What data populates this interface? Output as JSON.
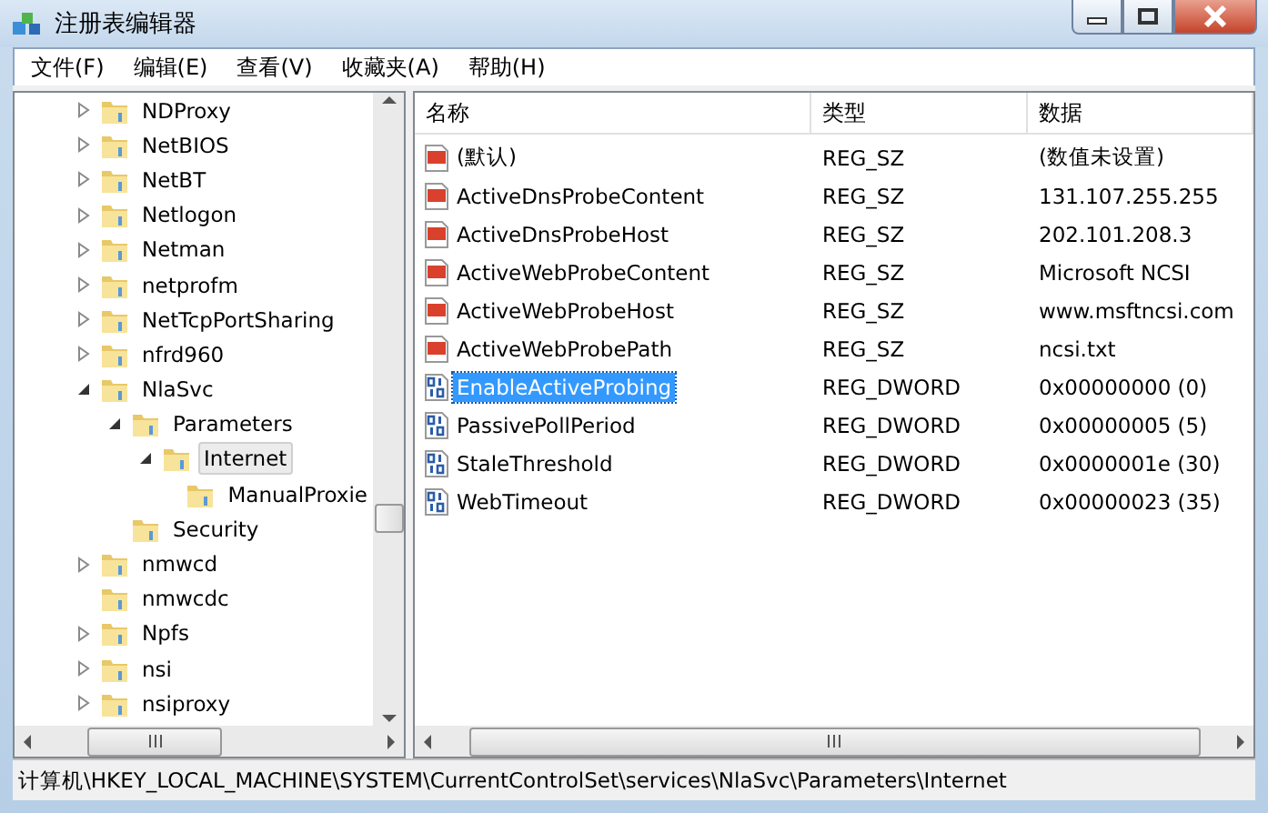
{
  "window": {
    "title": "注册表编辑器"
  },
  "menu": [
    {
      "label": "文件(F)"
    },
    {
      "label": "编辑(E)"
    },
    {
      "label": "查看(V)"
    },
    {
      "label": "收藏夹(A)"
    },
    {
      "label": "帮助(H)"
    }
  ],
  "tree": [
    {
      "label": "NDProxy",
      "expandable": true,
      "expanded": false,
      "selected": false
    },
    {
      "label": "NetBIOS",
      "expandable": true,
      "expanded": false,
      "selected": false
    },
    {
      "label": "NetBT",
      "expandable": true,
      "expanded": false,
      "selected": false
    },
    {
      "label": "Netlogon",
      "expandable": true,
      "expanded": false,
      "selected": false
    },
    {
      "label": "Netman",
      "expandable": true,
      "expanded": false,
      "selected": false
    },
    {
      "label": "netprofm",
      "expandable": true,
      "expanded": false,
      "selected": false
    },
    {
      "label": "NetTcpPortSharing",
      "expandable": true,
      "expanded": false,
      "selected": false
    },
    {
      "label": "nfrd960",
      "expandable": true,
      "expanded": false,
      "selected": false
    },
    {
      "label": "NlaSvc",
      "expandable": true,
      "expanded": true,
      "selected": false,
      "children": [
        {
          "label": "Parameters",
          "expandable": true,
          "expanded": true,
          "selected": false,
          "children": [
            {
              "label": "Internet",
              "expandable": true,
              "expanded": true,
              "selected": true,
              "children": [
                {
                  "label": "ManualProxie",
                  "expandable": false,
                  "expanded": false,
                  "selected": false
                }
              ]
            }
          ]
        },
        {
          "label": "Security",
          "expandable": false,
          "expanded": false,
          "selected": false
        }
      ]
    },
    {
      "label": "nmwcd",
      "expandable": true,
      "expanded": false,
      "selected": false
    },
    {
      "label": "nmwcdc",
      "expandable": false,
      "expanded": false,
      "selected": false
    },
    {
      "label": "Npfs",
      "expandable": true,
      "expanded": false,
      "selected": false
    },
    {
      "label": "nsi",
      "expandable": true,
      "expanded": false,
      "selected": false
    },
    {
      "label": "nsiproxy",
      "expandable": true,
      "expanded": false,
      "selected": false
    }
  ],
  "table": {
    "columns": [
      "名称",
      "类型",
      "数据"
    ],
    "rows": [
      {
        "kind": "string",
        "name": "(默认)",
        "type": "REG_SZ",
        "data": "(数值未设置)",
        "selected": false
      },
      {
        "kind": "string",
        "name": "ActiveDnsProbeContent",
        "type": "REG_SZ",
        "data": "131.107.255.255",
        "selected": false
      },
      {
        "kind": "string",
        "name": "ActiveDnsProbeHost",
        "type": "REG_SZ",
        "data": "202.101.208.3",
        "selected": false
      },
      {
        "kind": "string",
        "name": "ActiveWebProbeContent",
        "type": "REG_SZ",
        "data": "Microsoft NCSI",
        "selected": false
      },
      {
        "kind": "string",
        "name": "ActiveWebProbeHost",
        "type": "REG_SZ",
        "data": "www.msftncsi.com",
        "selected": false
      },
      {
        "kind": "string",
        "name": "ActiveWebProbePath",
        "type": "REG_SZ",
        "data": "ncsi.txt",
        "selected": false
      },
      {
        "kind": "number",
        "name": "EnableActiveProbing",
        "type": "REG_DWORD",
        "data": "0x00000000 (0)",
        "selected": true
      },
      {
        "kind": "number",
        "name": "PassivePollPeriod",
        "type": "REG_DWORD",
        "data": "0x00000005 (5)",
        "selected": false
      },
      {
        "kind": "number",
        "name": "StaleThreshold",
        "type": "REG_DWORD",
        "data": "0x0000001e (30)",
        "selected": false
      },
      {
        "kind": "number",
        "name": "WebTimeout",
        "type": "REG_DWORD",
        "data": "0x00000023 (35)",
        "selected": false
      }
    ]
  },
  "status_bar": "计算机\\HKEY_LOCAL_MACHINE\\SYSTEM\\CurrentControlSet\\services\\NlaSvc\\Parameters\\Internet"
}
